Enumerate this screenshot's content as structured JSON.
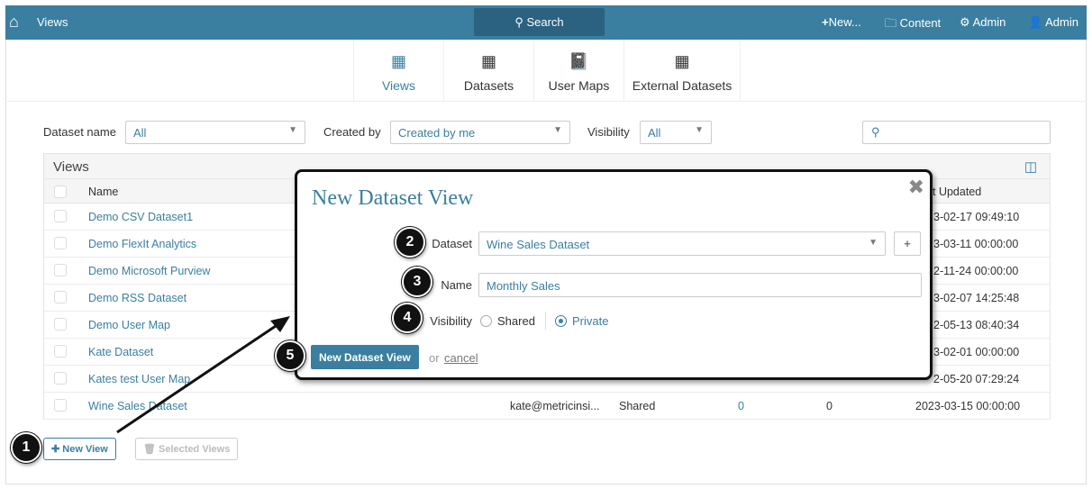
{
  "topbar": {
    "title": "Views",
    "search": "Search",
    "new": "New...",
    "content": "Content",
    "admin_settings": "Admin",
    "user": "Admin"
  },
  "tabs": [
    {
      "label": "Views"
    },
    {
      "label": "Datasets"
    },
    {
      "label": "User Maps"
    },
    {
      "label": "External Datasets"
    }
  ],
  "filters": {
    "dataset_label": "Dataset name",
    "dataset_value": "All",
    "created_label": "Created by",
    "created_value": "Created by me",
    "visibility_label": "Visibility",
    "visibility_value": "All"
  },
  "panel": {
    "title": "Views",
    "col_name": "Name",
    "col_updated_partial": "t Updated"
  },
  "rows": [
    {
      "name": "Demo CSV Dataset1",
      "updated": "3-02-17 09:49:10"
    },
    {
      "name": "Demo FlexIt Analytics",
      "updated": "3-03-11 00:00:00"
    },
    {
      "name": "Demo Microsoft Purview",
      "updated": "2-11-24 00:00:00"
    },
    {
      "name": "Demo RSS Dataset",
      "updated": "3-02-07 14:25:48"
    },
    {
      "name": "Demo User Map",
      "updated": "2-05-13 08:40:34"
    },
    {
      "name": "Kate Dataset",
      "updated": "3-02-01 00:00:00"
    },
    {
      "name": "Kates test User Map",
      "updated": "2-05-20 07:29:24"
    },
    {
      "name": "Wine Sales Dataset",
      "owner": "kate@metricinsi...",
      "visibility": "Shared",
      "n1": "0",
      "n2": "0",
      "updated": "2023-03-15 00:00:00"
    }
  ],
  "buttons": {
    "new_view": "New View",
    "selected_views": "Selected Views"
  },
  "modal": {
    "title": "New Dataset View",
    "dataset_label": "Dataset",
    "dataset_value": "Wine Sales Dataset",
    "name_label": "Name",
    "name_value": "Monthly Sales",
    "visibility_label": "Visibility",
    "opt_shared": "Shared",
    "opt_private": "Private",
    "submit": "New Dataset View",
    "or": "or",
    "cancel": "cancel"
  },
  "badges": [
    "1",
    "2",
    "3",
    "4",
    "5"
  ]
}
